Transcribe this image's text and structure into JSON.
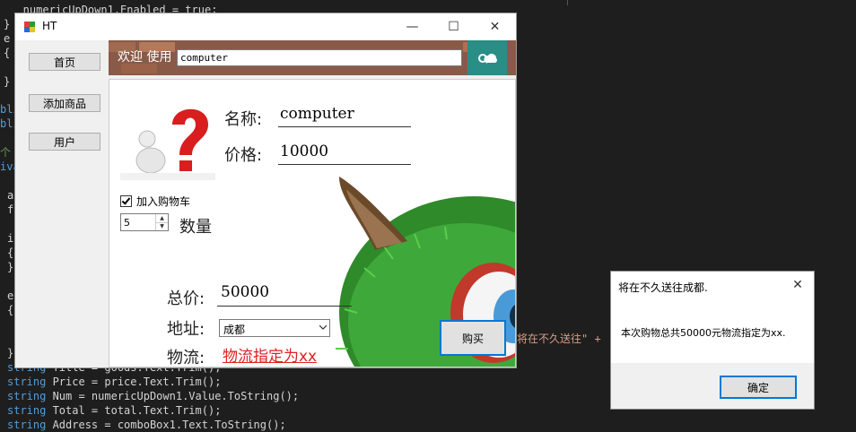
{
  "editor": {
    "lines_top": [
      {
        "text": "   numericUpDown1.Enabled = true;"
      },
      {
        "text": "}"
      },
      {
        "text": "e"
      },
      {
        "text": "{"
      },
      {
        "text": "}"
      }
    ],
    "left_fragments": [
      "bli",
      "bli",
      "个 号",
      "iva",
      "a",
      "f",
      "i",
      "{",
      "}",
      "e",
      "{",
      "}"
    ],
    "lines_bottom": [
      {
        "kw": "string",
        "rest": " Price = price.Text.Trim();"
      },
      {
        "kw": "string",
        "rest": " Num = numericUpDown1.Value.ToString();"
      },
      {
        "kw": "string",
        "rest": " Total = total.Text.Trim();"
      },
      {
        "kw": "string",
        "rest": " Address = comboBox1.Text.ToString();"
      }
    ],
    "partial_line": "string Title = goods.Text.Trim();",
    "code_tail": "将在不久送往\" +"
  },
  "window": {
    "title": "HT",
    "minimize_glyph": "—",
    "maximize_glyph": "☐",
    "close_glyph": "✕"
  },
  "nav": {
    "home": "首页",
    "add_product": "添加商品",
    "user": "用户"
  },
  "banner": {
    "welcome": "欢迎 使用",
    "search_value": "computer",
    "cloud_icon": "cloud-search-icon"
  },
  "product": {
    "name_label": "名称:",
    "name_value": "computer",
    "price_label": "价格:",
    "price_value": "10000",
    "add_to_cart_label": "加入购物车",
    "add_to_cart_checked": true,
    "quantity_value": "5",
    "quantity_label": "数量",
    "total_label": "总价:",
    "total_value": "50000",
    "address_label": "地址:",
    "address_value": "成都",
    "logistics_label": "物流:",
    "logistics_value": "物流指定为xx",
    "buy_button": "购买"
  },
  "message_box": {
    "title": "将在不久送往成都.",
    "body": "本次购物总共50000元物流指定为xx.",
    "ok_button": "确定",
    "close_glyph": "✕"
  },
  "colors": {
    "accent_blue": "#0078d7",
    "teal_button": "#2a8d86",
    "link_red": "#dd2222",
    "editor_bg": "#1e1e1e"
  }
}
